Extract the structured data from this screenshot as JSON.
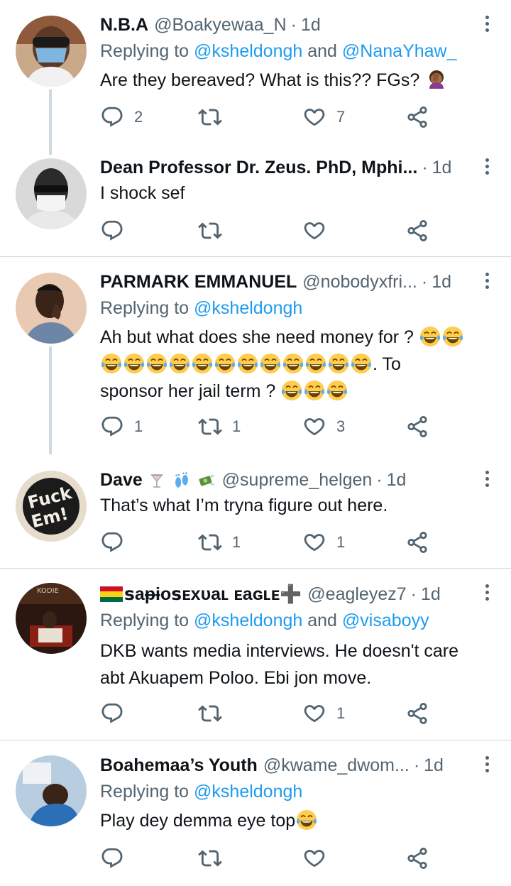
{
  "colors": {
    "text": "#0f1419",
    "secondary": "#536471",
    "link": "#1d9bf0",
    "divider": "#cfd9de"
  },
  "tweets": [
    {
      "name": "N.B.A",
      "handle": "@Boakyewaa_N",
      "time": "1d",
      "replying_label": "Replying to",
      "mentions": [
        "@ksheldongh",
        "@NanaYhaw_"
      ],
      "mention_joiner": "and",
      "text": "Are they bereaved? What is this?? FGs?",
      "trailing_emoji": "woman-facepalming",
      "counts": {
        "reply": "2",
        "retweet": "",
        "like": "7"
      }
    },
    {
      "name": "Dean Professor Dr. Zeus. PhD, Mphi...",
      "handle": "",
      "time": "1d",
      "text": "I shock sef",
      "counts": {
        "reply": "",
        "retweet": "",
        "like": ""
      }
    },
    {
      "name": "PARMARK EMMANUEL",
      "handle": "@nobodyxfri...",
      "time": "1d",
      "replying_label": "Replying to",
      "mentions": [
        "@ksheldongh"
      ],
      "text_line1": "Ah but what does she need money for ?",
      "text_line2_suffix": ". To",
      "text_line3": "sponsor her jail term ?",
      "emoji_name": "face-with-tears-of-joy",
      "counts": {
        "reply": "1",
        "retweet": "1",
        "like": "3"
      }
    },
    {
      "name": "Dave",
      "name_emojis": [
        "cocktail-glass",
        "footprints",
        "money-with-wings"
      ],
      "handle": "@supreme_helgen",
      "time": "1d",
      "text": "That’s what I’m tryna figure out here.",
      "counts": {
        "reply": "",
        "retweet": "1",
        "like": "1"
      }
    },
    {
      "name": "ꜱaᵽɨoꜱᴇxᴜaʟ ᴇaɢʟᴇ➕",
      "name_flag": "ghana-flag",
      "handle": "@eagleyez7",
      "time": "1d",
      "replying_label": "Replying to",
      "mentions": [
        "@ksheldongh",
        "@visaboyy"
      ],
      "mention_joiner": "and",
      "text_line1": "DKB wants media interviews. He doesn't care",
      "text_line2": "abt Akuapem Poloo. Ebi jon move.",
      "counts": {
        "reply": "",
        "retweet": "",
        "like": "1"
      }
    },
    {
      "name": "Boahemaa’s Youth",
      "handle": "@kwame_dwom...",
      "time": "1d",
      "replying_label": "Replying to",
      "mentions": [
        "@ksheldongh"
      ],
      "text": "Play dey demma eye top",
      "trailing_emoji": "face-with-tears-of-joy",
      "counts": {
        "reply": "",
        "retweet": "",
        "like": ""
      }
    }
  ],
  "dot_separator": "·"
}
